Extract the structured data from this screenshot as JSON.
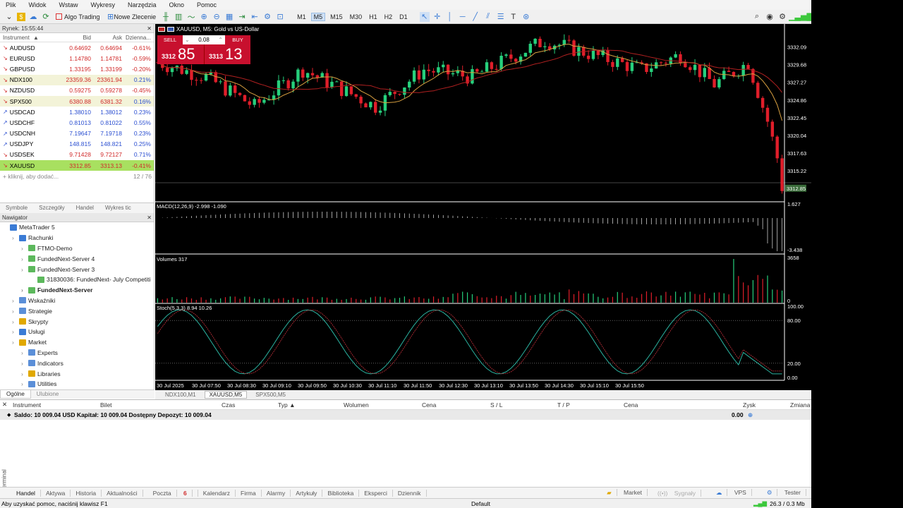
{
  "menu": [
    "Plik",
    "Widok",
    "Wstaw",
    "Wykresy",
    "Narzędzia",
    "Okno",
    "Pomoc"
  ],
  "toolbar": {
    "algo_trading": "Algo Trading",
    "new_order": "Nowe Zlecenie",
    "timeframes": [
      "M1",
      "M5",
      "M15",
      "M30",
      "H1",
      "H2",
      "D1"
    ],
    "active_timeframe": "M5"
  },
  "market_watch": {
    "title": "Rynek: 15:55:44",
    "headers": {
      "instrument": "Instrument",
      "bid": "Bid",
      "ask": "Ask",
      "change": "Dzienna..."
    },
    "rows": [
      {
        "sym": "AUDUSD",
        "bid": "0.64692",
        "ask": "0.64694",
        "chg": "-0.61%",
        "dir": "down",
        "hl": ""
      },
      {
        "sym": "EURUSD",
        "bid": "1.14780",
        "ask": "1.14781",
        "chg": "-0.59%",
        "dir": "down",
        "hl": ""
      },
      {
        "sym": "GBPUSD",
        "bid": "1.33195",
        "ask": "1.33199",
        "chg": "-0.20%",
        "dir": "down",
        "hl": ""
      },
      {
        "sym": "NDX100",
        "bid": "23359.36",
        "ask": "23361.94",
        "chg": "0.21%",
        "dir": "down",
        "hl": "row-hl"
      },
      {
        "sym": "NZDUSD",
        "bid": "0.59275",
        "ask": "0.59278",
        "chg": "-0.45%",
        "dir": "down",
        "hl": ""
      },
      {
        "sym": "SPX500",
        "bid": "6380.88",
        "ask": "6381.32",
        "chg": "0.16%",
        "dir": "down",
        "hl": "row-hl"
      },
      {
        "sym": "USDCAD",
        "bid": "1.38010",
        "ask": "1.38012",
        "chg": "0.23%",
        "dir": "up",
        "hl": ""
      },
      {
        "sym": "USDCHF",
        "bid": "0.81013",
        "ask": "0.81022",
        "chg": "0.55%",
        "dir": "up",
        "hl": ""
      },
      {
        "sym": "USDCNH",
        "bid": "7.19647",
        "ask": "7.19718",
        "chg": "0.23%",
        "dir": "up",
        "hl": ""
      },
      {
        "sym": "USDJPY",
        "bid": "148.815",
        "ask": "148.821",
        "chg": "0.25%",
        "dir": "up",
        "hl": ""
      },
      {
        "sym": "USDSEK",
        "bid": "9.71428",
        "ask": "9.72127",
        "chg": "0.71%",
        "dir": "down",
        "hl": ""
      },
      {
        "sym": "XAUUSD",
        "bid": "3312.85",
        "ask": "3313.13",
        "chg": "-0.41%",
        "dir": "down",
        "hl": "row-sel"
      }
    ],
    "add_hint": "kliknij, aby dodać...",
    "count": "12 / 76",
    "tabs": [
      "Symbole",
      "Szczegóły",
      "Handel",
      "Wykres tic"
    ]
  },
  "navigator": {
    "title": "Nawigator",
    "items": [
      {
        "label": "MetaTrader 5",
        "indent": 0,
        "color": "#3a7bd5",
        "bold": false
      },
      {
        "label": "Rachunki",
        "indent": 1,
        "color": "#3a7bd5",
        "bold": false
      },
      {
        "label": "FTMO-Demo",
        "indent": 2,
        "color": "#5cb85c",
        "bold": false
      },
      {
        "label": "FundedNext-Server 4",
        "indent": 2,
        "color": "#5cb85c",
        "bold": false
      },
      {
        "label": "FundedNext-Server 3",
        "indent": 2,
        "color": "#5cb85c",
        "bold": false
      },
      {
        "label": "31830036: FundedNext- July Competiti",
        "indent": 3,
        "color": "#5cb85c",
        "bold": false
      },
      {
        "label": "FundedNext-Server",
        "indent": 2,
        "color": "#5cb85c",
        "bold": true
      },
      {
        "label": "Wskaźniki",
        "indent": 1,
        "color": "#5b8fd8",
        "bold": false
      },
      {
        "label": "Strategie",
        "indent": 1,
        "color": "#5b8fd8",
        "bold": false
      },
      {
        "label": "Skrypty",
        "indent": 1,
        "color": "#e0a800",
        "bold": false
      },
      {
        "label": "Usługi",
        "indent": 1,
        "color": "#3a7bd5",
        "bold": false
      },
      {
        "label": "Market",
        "indent": 1,
        "color": "#e0a800",
        "bold": false
      },
      {
        "label": "Experts",
        "indent": 2,
        "color": "#5b8fd8",
        "bold": false
      },
      {
        "label": "Indicators",
        "indent": 2,
        "color": "#5b8fd8",
        "bold": false
      },
      {
        "label": "Libraries",
        "indent": 2,
        "color": "#e0a800",
        "bold": false
      },
      {
        "label": "Utilities",
        "indent": 2,
        "color": "#5b8fd8",
        "bold": false
      }
    ],
    "tabs": [
      "Ogólne",
      "Ulubione"
    ]
  },
  "chart": {
    "title": "XAUUSD, M5:  Gold vs US-Dollar",
    "sell_label": "SELL",
    "buy_label": "BUY",
    "lot": "0.08",
    "sell_price_small": "3312",
    "sell_price_big": "85",
    "buy_price_small": "3313",
    "buy_price_big": "13",
    "current_price": "3312.85",
    "price_ticks": [
      "3332.09",
      "3329.68",
      "3327.27",
      "3324.86",
      "3322.45",
      "3320.04",
      "3317.63",
      "3315.22"
    ],
    "macd_label": "MACD(12,26,9) -2.998 -1.090",
    "macd_ticks": [
      "1.627",
      "-3.438"
    ],
    "volumes_label": "Volumes 317",
    "volume_ticks": [
      "3658",
      "0"
    ],
    "stoch_label": "Stoch(5,3,3) 8.94 10.26",
    "stoch_ticks": [
      "100.00",
      "80.00",
      "20.00",
      "0.00"
    ],
    "time_ticks": [
      "30 Jul 2025",
      "30 Jul 07:50",
      "30 Jul 08:30",
      "30 Jul 09:10",
      "30 Jul 09:50",
      "30 Jul 10:30",
      "30 Jul 11:10",
      "30 Jul 11:50",
      "30 Jul 12:30",
      "30 Jul 13:10",
      "30 Jul 13:50",
      "30 Jul 14:30",
      "30 Jul 15:10",
      "30 Jul 15:50"
    ],
    "colors": {
      "bull": "#26d07c",
      "bear": "#e01e2a",
      "ma1": "#d9a040",
      "ma2": "#b02020"
    }
  },
  "chart_tabs": [
    "NDX100,M1",
    "XAUUSD,M5",
    "SPX500,M5"
  ],
  "active_chart_tab": "XAUUSD,M5",
  "terminal": {
    "columns": [
      "Instrument",
      "Bilet",
      "Czas",
      "Typ",
      "Wolumen",
      "Cena",
      "S / L",
      "T / P",
      "Cena",
      "Zysk",
      "Zmiana"
    ],
    "balance": "Saldo: 10 009.04 USD  Kapitał: 10 009.04  Dostępny Depozyt: 10 009.04",
    "profit": "0.00",
    "tabs": [
      "Handel",
      "Aktywa",
      "Historia",
      "Aktualności",
      "Poczta",
      "Kalendarz",
      "Firma",
      "Alarmy",
      "Artykuły",
      "Biblioteka",
      "Eksperci",
      "Dziennik"
    ],
    "mail_count": "6",
    "right_tabs": [
      "Market",
      "Sygnały",
      "VPS",
      "Tester"
    ],
    "side_label": "Terminal"
  },
  "status": {
    "help": "Aby uzyskać pomoc, naciśnij klawisz F1",
    "profile": "Default",
    "traffic": "26.3 / 0.3 Mb"
  }
}
